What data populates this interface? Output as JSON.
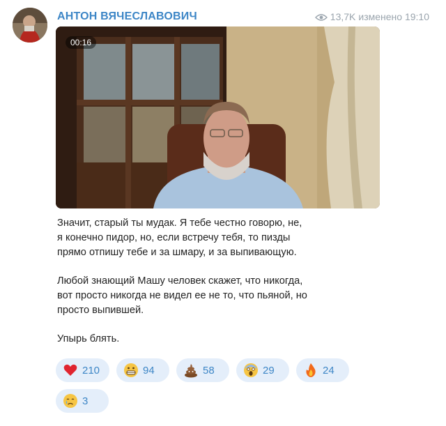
{
  "author": "АНТОН ВЯЧЕСЛАВОВИЧ",
  "views": "13,7K",
  "edited_time": "изменено 19:10",
  "video": {
    "duration": "00:16"
  },
  "paragraphs": [
    "Значит, старый ты мудак. Я тебе честно говорю, не,\nя конечно пидор, но, если встречу тебя, то пизды\nпрямо отпишу тебе и за шмару, и за выпивающую.",
    "Любой знающий Машу человек скажет, что никогда,\nвот просто никогда не видел ее не то, что пьяной, но\nпросто выпившей.",
    "Упырь блять."
  ],
  "reactions": [
    {
      "icon": "heart-icon",
      "count": "210"
    },
    {
      "icon": "grinning-face-icon",
      "count": "94"
    },
    {
      "icon": "poop-icon",
      "count": "58"
    },
    {
      "icon": "screaming-face-icon",
      "count": "29"
    },
    {
      "icon": "fire-icon",
      "count": "24"
    },
    {
      "icon": "crying-face-icon",
      "count": "3"
    }
  ],
  "colors": {
    "accent": "#3d86c6",
    "meta": "#9aa4ad",
    "reaction_bg": "#e4eefa"
  }
}
